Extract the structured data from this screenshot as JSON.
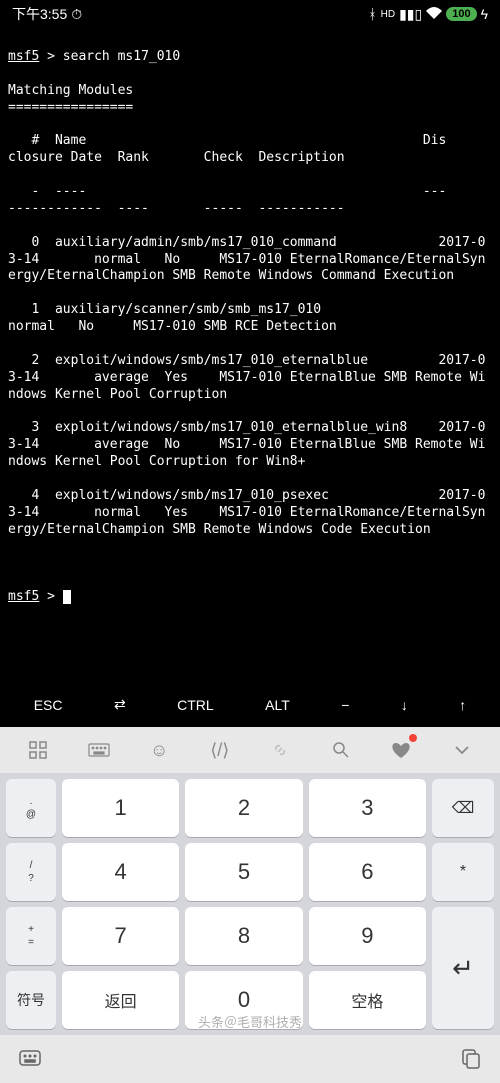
{
  "status": {
    "time": "下午3:55",
    "alarm": "⏰",
    "bluetooth": "✱",
    "signal": "ᴴᴰ",
    "wifi": "📶",
    "battery": "100",
    "charging": "⚡"
  },
  "prompt1": "msf5",
  "prompt_sep": " > ",
  "cmd": "search ms17_010",
  "heading": "Matching Modules",
  "underline_eq": "================",
  "cols": "   #  Name                                           Dis\nclosure Date  Rank       Check  Description",
  "dashes": "   -  ----                                           ---\n------------  ----       -----  -----------",
  "row0": "   0  auxiliary/admin/smb/ms17_010_command             2017-03-14       normal   No     MS17-010 EternalRomance/EternalSynergy/EternalChampion SMB Remote Windows Command Execution",
  "row1": "   1  auxiliary/scanner/smb/smb_ms17_010                                normal   No     MS17-010 SMB RCE Detection",
  "row2": "   2  exploit/windows/smb/ms17_010_eternalblue         2017-03-14       average  Yes    MS17-010 EternalBlue SMB Remote Windows Kernel Pool Corruption",
  "row3": "   3  exploit/windows/smb/ms17_010_eternalblue_win8    2017-03-14       average  No     MS17-010 EternalBlue SMB Remote Windows Kernel Pool Corruption for Win8+",
  "row4": "   4  exploit/windows/smb/ms17_010_psexec              2017-03-14       normal   Yes    MS17-010 EternalRomance/EternalSynergy/EternalChampion SMB Remote Windows Code Execution",
  "prompt2": "msf5",
  "termkeys": {
    "esc": "ESC",
    "tab": "⇄",
    "ctrl": "CTRL",
    "alt": "ALT",
    "minus": "−",
    "down": "↓",
    "up": "↑"
  },
  "keypad": {
    "s1a": ".",
    "s1b": "@",
    "s2a": "/",
    "s2b": "?",
    "s3a": "+",
    "s3b": "=",
    "s4a": "-",
    "s4b": "_",
    "k1": "1",
    "k2": "2",
    "k3": "3",
    "k4": "4",
    "k5": "5",
    "k6": "6",
    "k7": "7",
    "k8": "8",
    "k9": "9",
    "k0": "0",
    "back": "⌫",
    "star": "*",
    "enter": "↵",
    "symbol": "符号",
    "return": "返回",
    "space": "空格"
  },
  "watermark": "头条＠毛哥科技秀"
}
